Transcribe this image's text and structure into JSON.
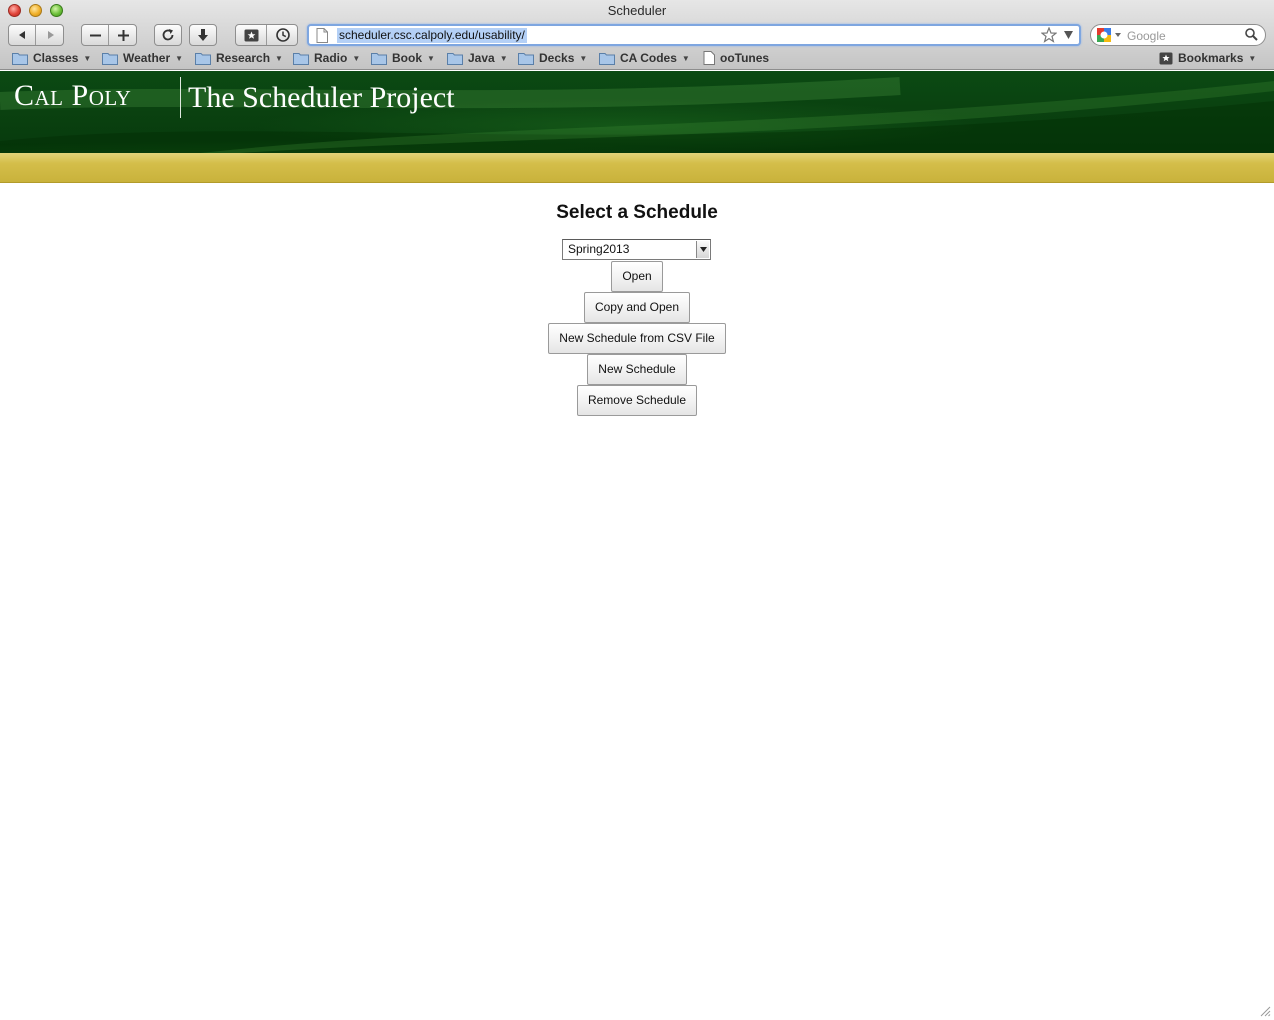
{
  "window": {
    "title": "Scheduler"
  },
  "toolbar": {
    "url": "scheduler.csc.calpoly.edu/usability/",
    "search_placeholder": "Google",
    "back_icon": "back-arrow-icon",
    "forward_icon": "forward-arrow-icon",
    "zoom_out_icon": "minus-icon",
    "zoom_in_icon": "plus-icon",
    "reload_icon": "reload-icon",
    "download_icon": "download-icon",
    "bookmarks_icon": "bookmarks-icon",
    "history_icon": "clock-icon"
  },
  "bookmarks_bar": {
    "items": [
      {
        "label": "Classes",
        "type": "folder"
      },
      {
        "label": "Weather",
        "type": "folder"
      },
      {
        "label": "Research",
        "type": "folder"
      },
      {
        "label": "Radio",
        "type": "folder"
      },
      {
        "label": "Book",
        "type": "folder"
      },
      {
        "label": "Java",
        "type": "folder"
      },
      {
        "label": "Decks",
        "type": "folder"
      },
      {
        "label": "CA Codes",
        "type": "folder"
      },
      {
        "label": "ooTunes",
        "type": "page"
      }
    ],
    "bookmarks_menu": "Bookmarks"
  },
  "header": {
    "brand": "Cal Poly",
    "project_title": "The Scheduler Project",
    "colors": {
      "green": "#0a4210",
      "gold": "#d4be4a"
    }
  },
  "main": {
    "heading": "Select a Schedule",
    "selected_schedule": "Spring2013",
    "buttons": {
      "open": "Open",
      "copy_and_open": "Copy and Open",
      "new_from_csv": "New Schedule from CSV File",
      "new_schedule": "New Schedule",
      "remove_schedule": "Remove Schedule"
    }
  }
}
